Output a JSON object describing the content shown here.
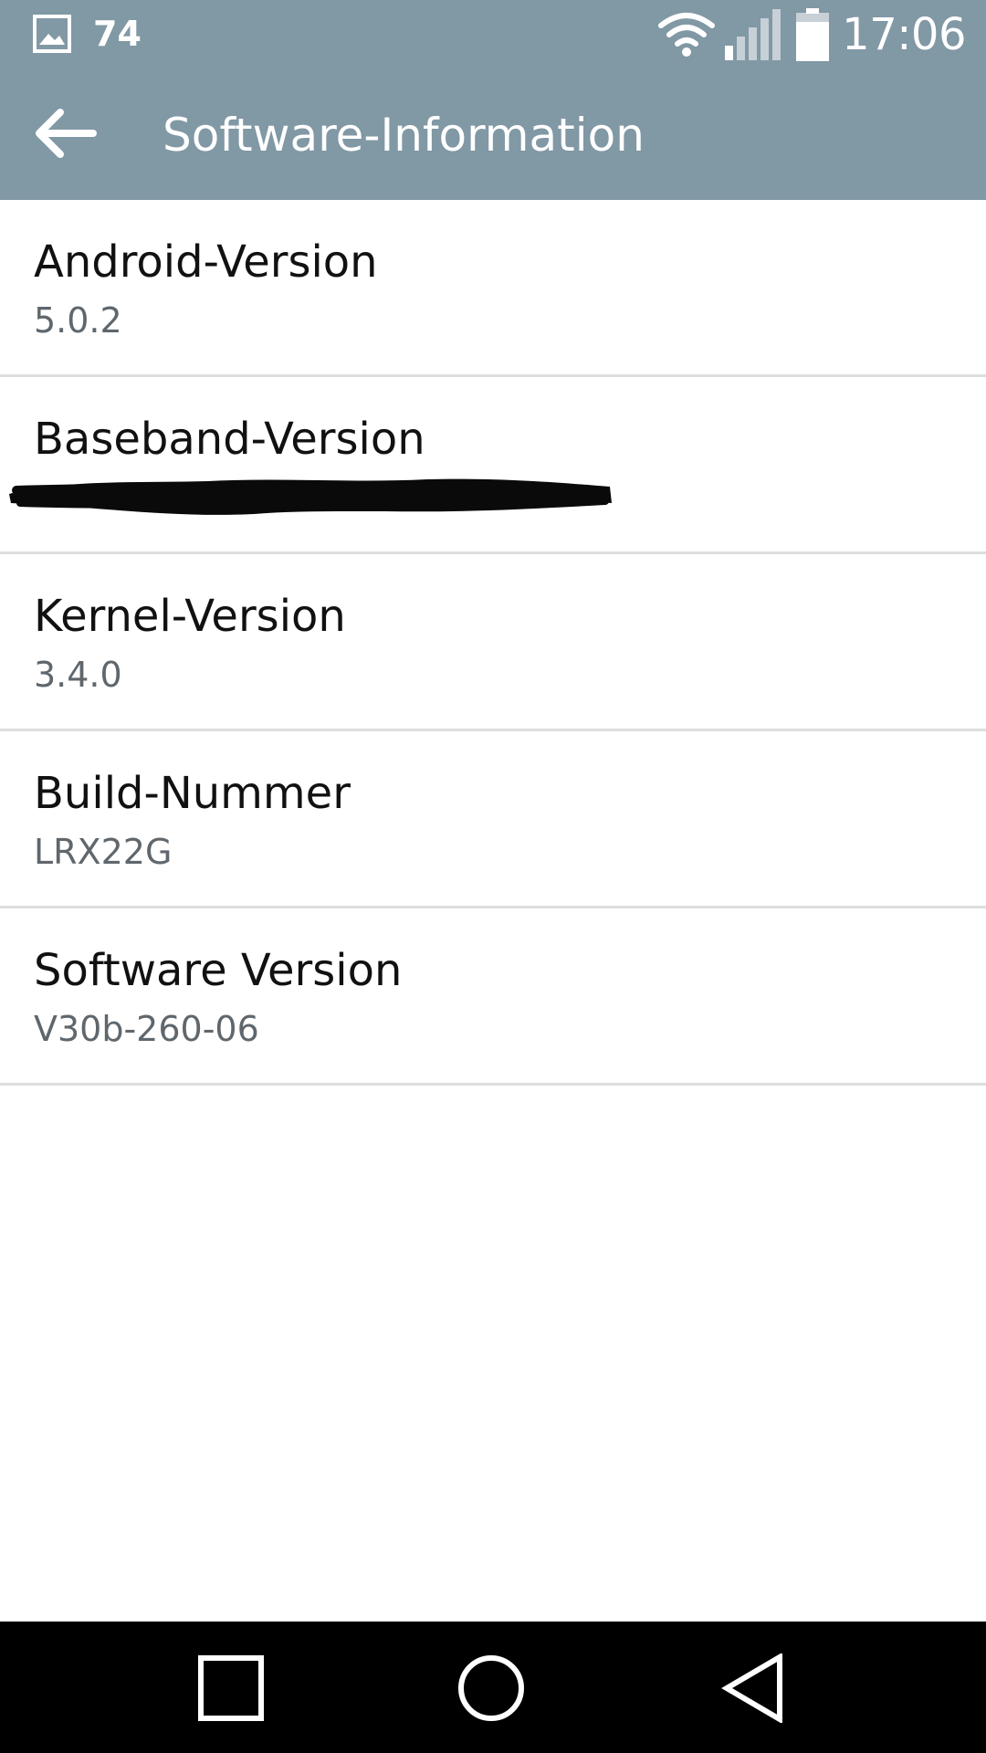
{
  "status_bar": {
    "notification_icon": "gallery-icon",
    "notification_count": "74",
    "icons": [
      "wifi-icon",
      "signal-icon",
      "battery-icon"
    ],
    "time": "17:06"
  },
  "app_bar": {
    "back_icon": "arrow-left-icon",
    "title": "Software-Information"
  },
  "items": [
    {
      "title": "Android-Version",
      "value": "5.0.2"
    },
    {
      "title": "Baseband-Version",
      "value": "",
      "value_redacted": true
    },
    {
      "title": "Kernel-Version",
      "value": "3.4.0"
    },
    {
      "title": "Build-Nummer",
      "value": "LRX22G"
    },
    {
      "title": "Software Version",
      "value": "V30b-260-06"
    }
  ],
  "nav_bar": {
    "buttons": [
      "recent-apps-icon",
      "home-icon",
      "back-triangle-icon"
    ]
  },
  "colors": {
    "app_bar": "#8198a5",
    "divider": "#dedede",
    "title_text": "#111111",
    "value_text": "#5f676d",
    "nav_bar": "#000000"
  }
}
